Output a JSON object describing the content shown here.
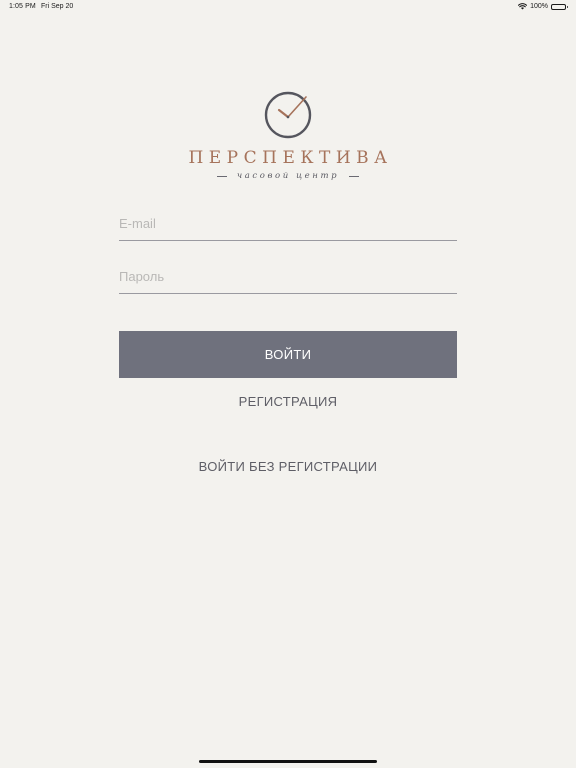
{
  "status_bar": {
    "time": "1:05 PM",
    "date": "Fri Sep 20",
    "battery_text": "100%",
    "battery_level": 1.0
  },
  "logo": {
    "name": "ПЕРСПЕКТИВА",
    "subtitle": "часовой центр",
    "icon": "clock-icon",
    "brand_color": "#a6735b",
    "ring_color": "#55565e"
  },
  "form": {
    "email_placeholder": "E-mail",
    "email_value": "",
    "password_placeholder": "Пароль",
    "password_value": "",
    "login_label": "ВОЙТИ",
    "register_label": "РЕГИСТРАЦИЯ",
    "guest_label": "ВОЙТИ БЕЗ РЕГИСТРАЦИИ"
  },
  "colors": {
    "background": "#f3f2ee",
    "button": "#6f717d",
    "text": "#5e5e66"
  }
}
